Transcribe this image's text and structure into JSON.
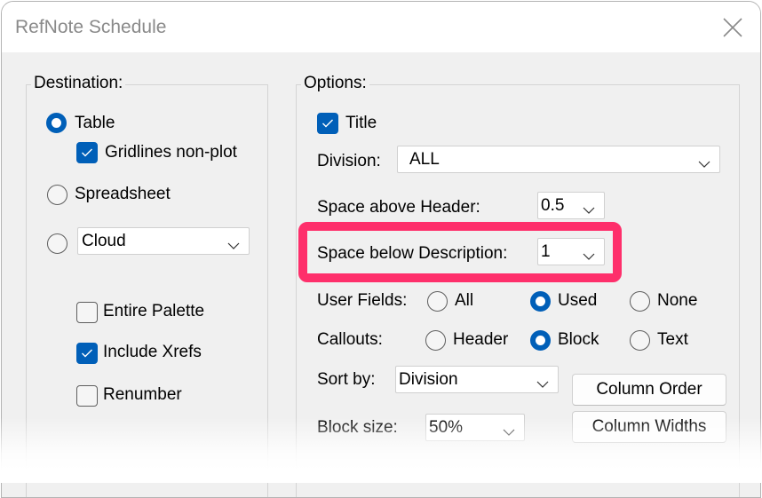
{
  "window": {
    "title": "RefNote Schedule",
    "close_icon": "close-icon"
  },
  "destination": {
    "legend": "Destination:",
    "table": {
      "label": "Table",
      "selected": true
    },
    "gridlines": {
      "label": "Gridlines non-plot",
      "checked": true
    },
    "spreadsheet": {
      "label": "Spreadsheet",
      "selected": false
    },
    "cloud": {
      "selected": false,
      "combo_value": "Cloud"
    },
    "entire_palette": {
      "label": "Entire Palette",
      "checked": false
    },
    "include_xrefs": {
      "label": "Include Xrefs",
      "checked": true
    },
    "renumber": {
      "label": "Renumber",
      "checked": false
    }
  },
  "options": {
    "legend": "Options:",
    "title": {
      "label": "Title",
      "checked": true
    },
    "division": {
      "label": "Division:",
      "value": "ALL"
    },
    "space_above_header": {
      "label": "Space above Header:",
      "value": "0.5"
    },
    "space_below_description": {
      "label": "Space below Description:",
      "value": "1"
    },
    "user_fields": {
      "label": "User Fields:",
      "options": [
        {
          "label": "All",
          "selected": false
        },
        {
          "label": "Used",
          "selected": true
        },
        {
          "label": "None",
          "selected": false
        }
      ]
    },
    "callouts": {
      "label": "Callouts:",
      "options": [
        {
          "label": "Header",
          "selected": false
        },
        {
          "label": "Block",
          "selected": true
        },
        {
          "label": "Text",
          "selected": false
        }
      ]
    },
    "sort_by": {
      "label": "Sort by:",
      "value": "Division"
    },
    "block_size": {
      "label": "Block size:",
      "value": "50%"
    },
    "column_order_button": "Column Order",
    "column_widths_button": "Column Widths"
  },
  "colors": {
    "accent": "#005fb8",
    "highlight": "#fe2f6b",
    "dialog_bg": "#f0f0f0"
  }
}
